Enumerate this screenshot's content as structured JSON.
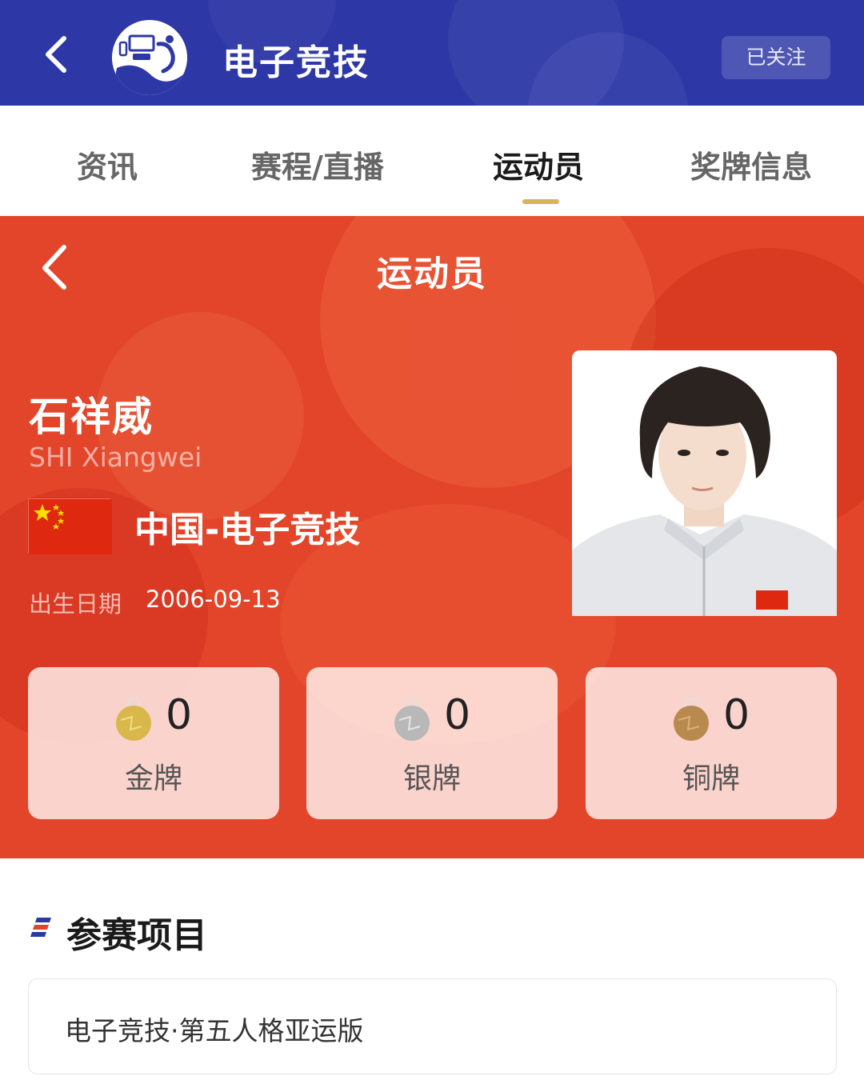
{
  "header": {
    "title": "电子竞技",
    "follow_label": "已关注",
    "brand_color": "#2d37a6"
  },
  "tabs": [
    {
      "label": "资讯",
      "active": false
    },
    {
      "label": "赛程/直播",
      "active": false
    },
    {
      "label": "运动员",
      "active": true
    },
    {
      "label": "奖牌信息",
      "active": false
    }
  ],
  "athlete_page": {
    "title": "运动员",
    "background_color": "#e2452a",
    "name_cn": "石祥威",
    "name_en": "SHI Xiangwei",
    "team": "中国-电子竞技",
    "dob_label": "出生日期",
    "dob_value": "2006-09-13",
    "medals": [
      {
        "type": "gold",
        "count": "0",
        "label": "金牌",
        "color": "#d8b84a"
      },
      {
        "type": "silver",
        "count": "0",
        "label": "银牌",
        "color": "#b8b8b8"
      },
      {
        "type": "bronze",
        "count": "0",
        "label": "铜牌",
        "color": "#b98a4e"
      }
    ]
  },
  "events": {
    "title": "参赛项目",
    "items": [
      "电子竞技·第五人格亚运版"
    ]
  },
  "icons": {
    "back": "chevron-left-icon",
    "sport_logo": "esports-logo-icon",
    "flag": "china-flag-icon",
    "medal": "medal-icon",
    "section_marker": "section-stripes-icon"
  }
}
